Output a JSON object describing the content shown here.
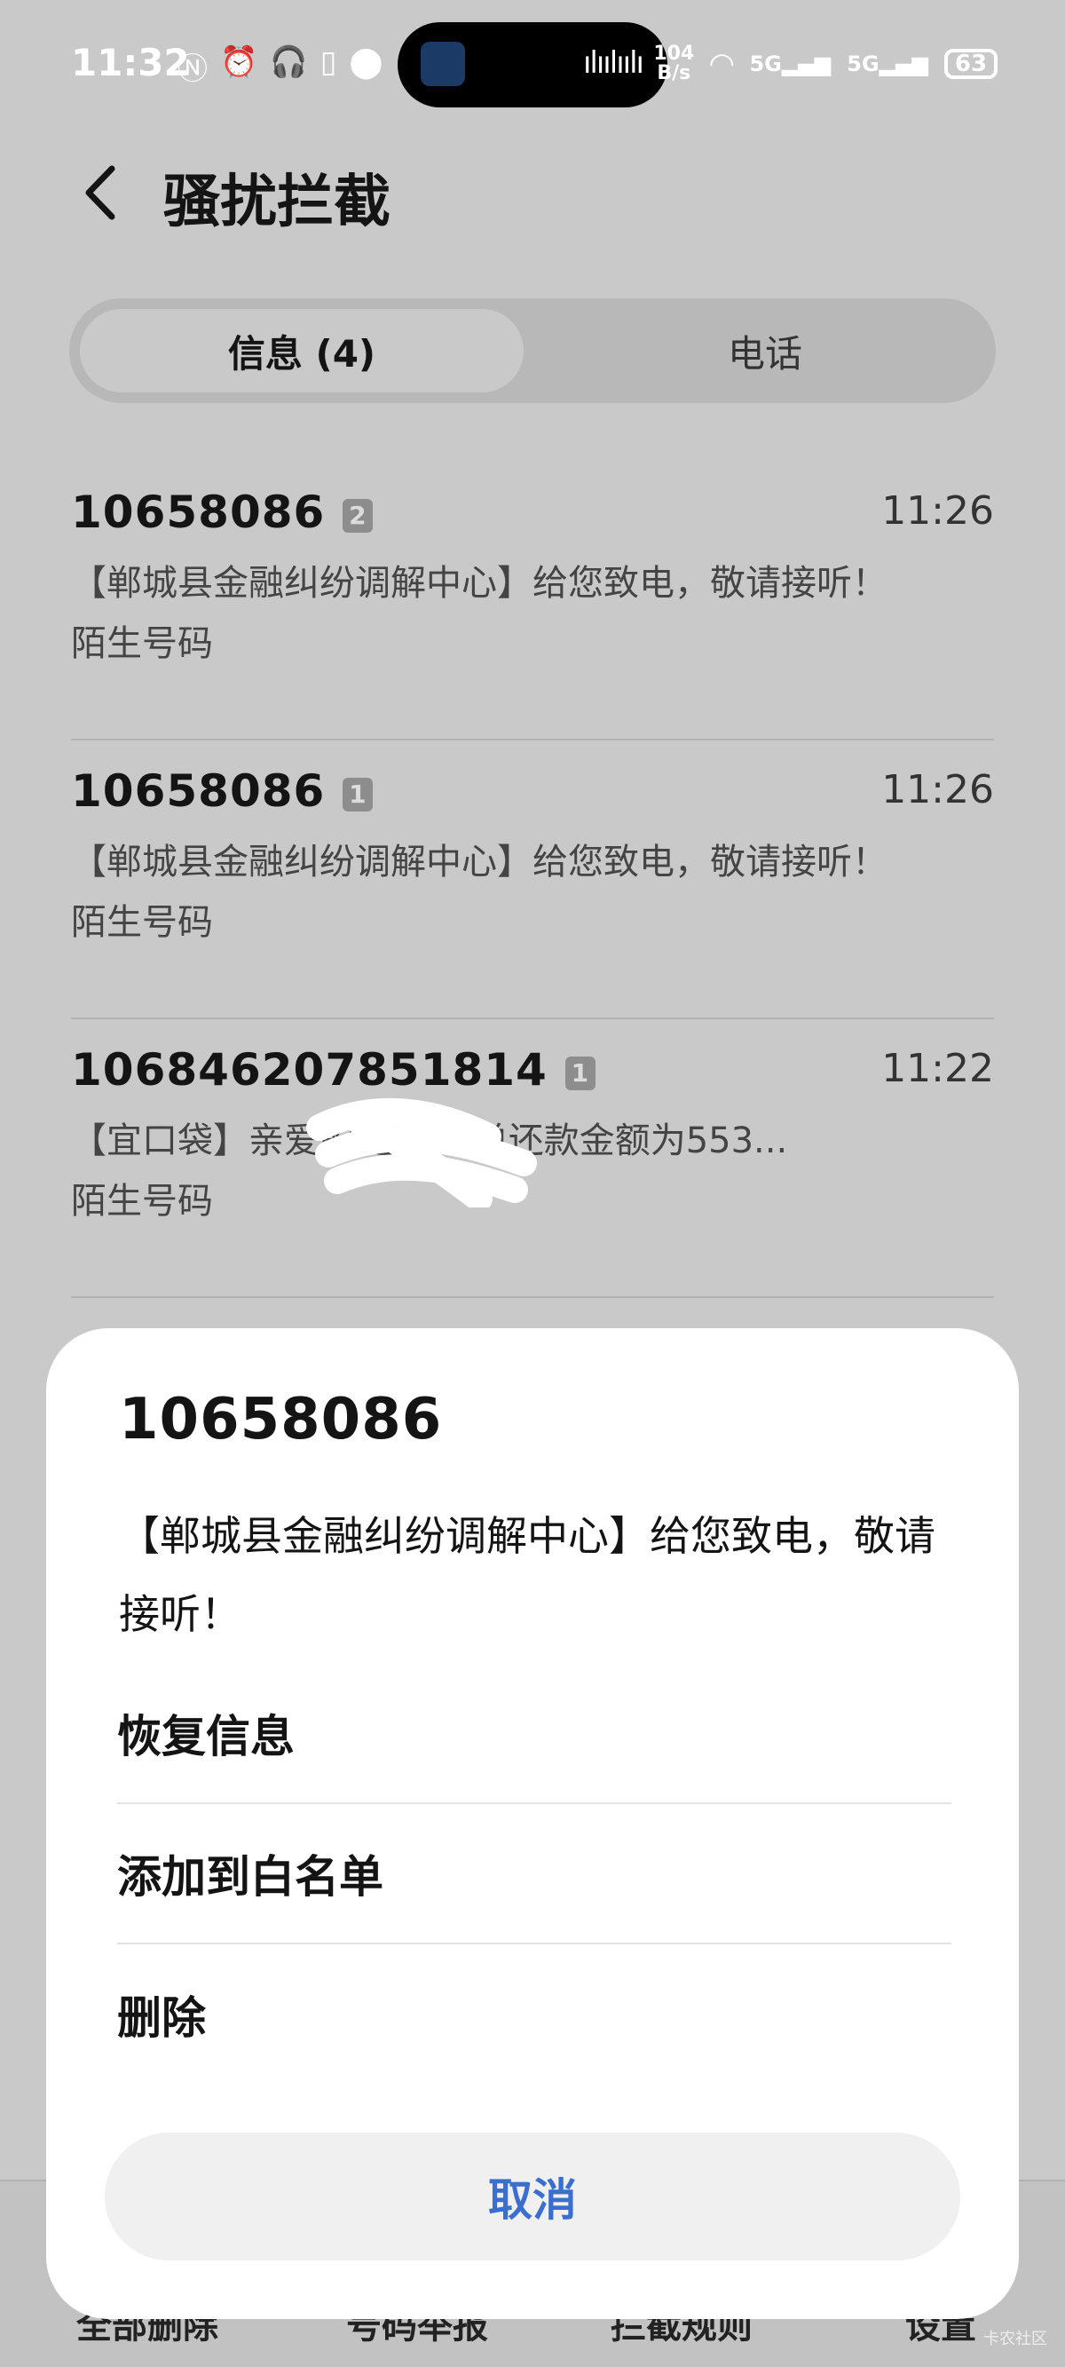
{
  "status_bar": {
    "time": "11:32",
    "left_icons": [
      "nfc-icon",
      "alarm-icon",
      "headphones-icon",
      "battery-small-icon",
      "location-icon"
    ],
    "net_speed_value": "104",
    "net_speed_unit": "B/s",
    "signal1_label": "5G",
    "signal2_label": "5G",
    "battery": "63"
  },
  "header": {
    "title": "骚扰拦截"
  },
  "tabs": {
    "messages": "信息 (4)",
    "calls": "电话"
  },
  "messages": [
    {
      "number": "10658086",
      "count": "2",
      "time": "11:26",
      "body": "【郸城县金融纠纷调解中心】给您致电，敬请接听！",
      "tag": "陌生号码"
    },
    {
      "number": "10658086",
      "count": "1",
      "time": "11:26",
      "body": "【郸城县金融纠纷调解中心】给您致电，敬请接听！",
      "tag": "陌生号码"
    },
    {
      "number": "106846207851814",
      "count": "1",
      "time": "11:22",
      "body": "【宜口袋】亲爱的        您的订单还款金额为553...",
      "tag": "陌生号码"
    }
  ],
  "bottom_bar": {
    "items": [
      "全部删除",
      "号码举报",
      "拦截规则",
      "设置"
    ]
  },
  "sheet": {
    "number": "10658086",
    "message": "【郸城县金融纠纷调解中心】给您致电，敬请接听！",
    "options": [
      "恢复信息",
      "添加到白名单",
      "删除"
    ],
    "cancel": "取消"
  },
  "watermark": "卡农社区",
  "colors": {
    "accent": "#3a6fd0",
    "dim_background": "#c9c9c9",
    "sheet": "#ffffff"
  }
}
